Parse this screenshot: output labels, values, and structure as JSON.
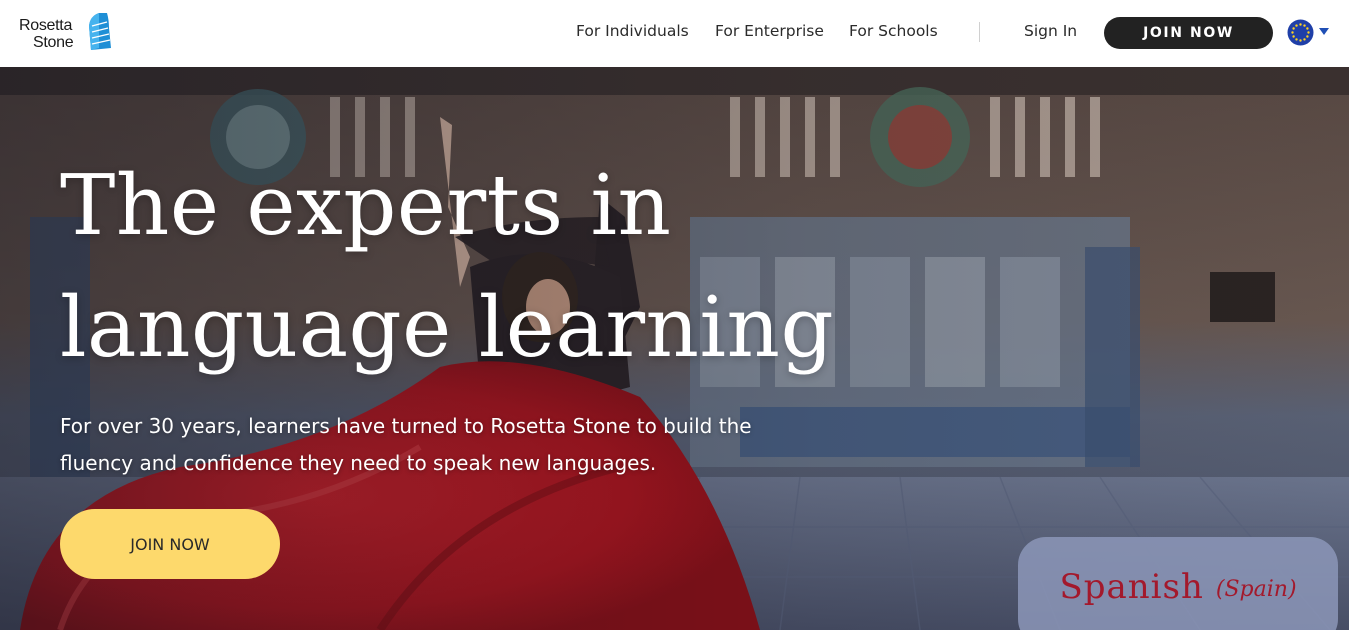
{
  "brand": {
    "logo_line1": "Rosetta",
    "logo_line2": "Stone",
    "color_dark": "#222222",
    "color_accent_yellow": "#fdd96c",
    "color_language_red": "#a3192c"
  },
  "header": {
    "nav": [
      {
        "label": "For Individuals"
      },
      {
        "label": "For Enterprise"
      },
      {
        "label": "For Schools"
      }
    ],
    "sign_in": "Sign In",
    "join_now": "JOIN NOW",
    "language_selector_icon": "eu-flag-globe-icon"
  },
  "hero": {
    "title_line1": "The experts in",
    "title_line2": "language learning",
    "subtitle_line1": "For over 30 years, learners have turned to Rosetta Stone to build the",
    "subtitle_line2": "fluency and confidence they need to speak new languages.",
    "cta": "JOIN NOW",
    "language_card": {
      "name": "Spanish",
      "region": "(Spain)"
    }
  }
}
